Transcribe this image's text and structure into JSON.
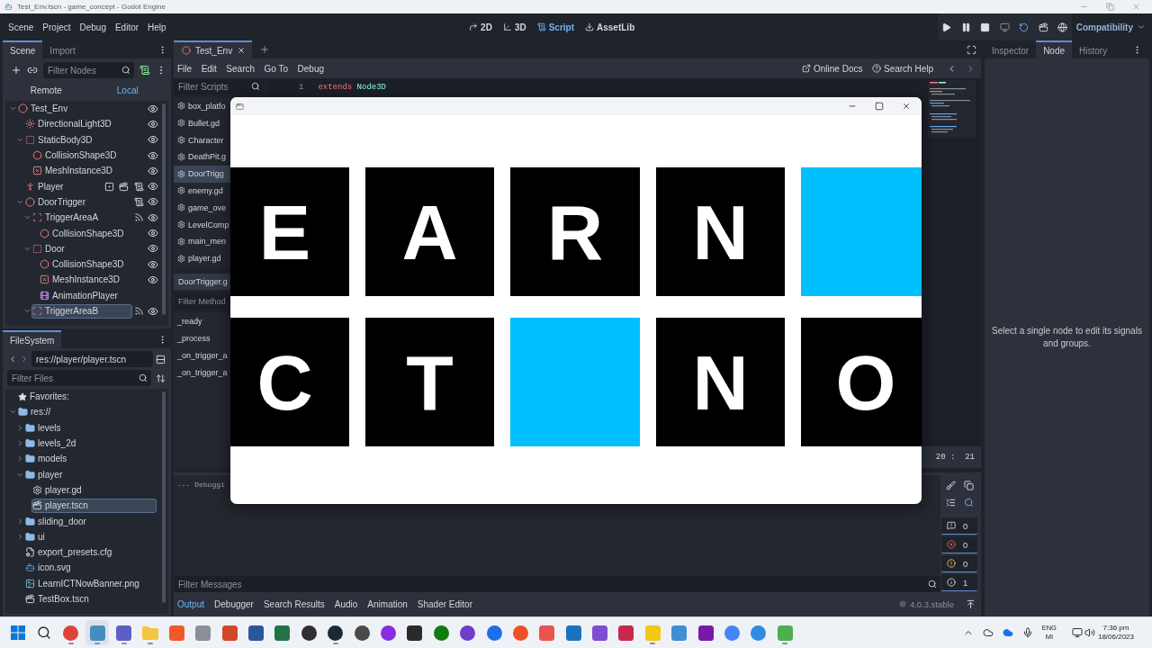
{
  "window": {
    "title": "Test_Env.tscn - game_concept - Godot Engine"
  },
  "menu_bar": {
    "menus": [
      "Scene",
      "Project",
      "Debug",
      "Editor",
      "Help"
    ],
    "workspaces": [
      {
        "kind": "canvas",
        "label": "2D",
        "selected": false
      },
      {
        "kind": "spatial",
        "label": "3D",
        "selected": false
      },
      {
        "kind": "script",
        "label": "Script",
        "selected": true
      },
      {
        "kind": "assetlib",
        "label": "AssetLib",
        "selected": false
      }
    ],
    "renderer": "Compatibility"
  },
  "scene_dock": {
    "tabs": [
      {
        "label": "Scene",
        "selected": true
      },
      {
        "label": "Import",
        "selected": false
      }
    ],
    "filter": {
      "placeholder": "Filter Nodes"
    },
    "modes": [
      {
        "label": "Remote",
        "selected": false
      },
      {
        "label": "Local",
        "selected": true
      }
    ],
    "tree": [
      {
        "name": "Test_Env",
        "kind": "node3d",
        "expanded": true,
        "selected": false,
        "visibility_toggle": true,
        "children": [
          {
            "name": "DirectionalLight3D",
            "kind": "light",
            "selected": false,
            "visibility_toggle": true
          },
          {
            "name": "StaticBody3D",
            "kind": "body",
            "expanded": true,
            "selected": false,
            "visibility_toggle": true,
            "children": [
              {
                "name": "CollisionShape3D",
                "kind": "shape",
                "selected": false,
                "visibility_toggle": true
              },
              {
                "name": "MeshInstance3D",
                "kind": "mesh",
                "selected": false,
                "visibility_toggle": true
              }
            ]
          },
          {
            "name": "Player",
            "kind": "character",
            "selected": false,
            "visibility_toggle": true,
            "indicators": [
              {
                "kind": "group"
              },
              {
                "kind": "scene"
              },
              {
                "kind": "script"
              }
            ]
          },
          {
            "name": "DoorTrigger",
            "kind": "node3d",
            "expanded": true,
            "selected": false,
            "visibility_toggle": true,
            "indicators": [
              {
                "kind": "script"
              }
            ],
            "children": [
              {
                "name": "TriggerAreaA",
                "kind": "area",
                "expanded": true,
                "selected": false,
                "visibility_toggle": true,
                "indicators": [
                  {
                    "kind": "signal"
                  }
                ],
                "children": [
                  {
                    "name": "CollisionShape3D",
                    "kind": "shape",
                    "selected": false,
                    "visibility_toggle": true
                  }
                ]
              },
              {
                "name": "Door",
                "kind": "body",
                "expanded": true,
                "selected": false,
                "visibility_toggle": true,
                "children": [
                  {
                    "name": "CollisionShape3D",
                    "kind": "shape",
                    "selected": false,
                    "visibility_toggle": true
                  },
                  {
                    "name": "MeshInstance3D",
                    "kind": "mesh",
                    "selected": false,
                    "visibility_toggle": true
                  },
                  {
                    "name": "AnimationPlayer",
                    "kind": "animation",
                    "selected": false,
                    "visibility_toggle": false
                  }
                ]
              },
              {
                "name": "TriggerAreaB",
                "kind": "area",
                "expanded": true,
                "selected": true,
                "visibility_toggle": true,
                "indicators": [
                  {
                    "kind": "signal"
                  }
                ]
              }
            ]
          }
        ]
      }
    ]
  },
  "filesystem_dock": {
    "tabs": [
      {
        "label": "FileSystem",
        "selected": true
      }
    ],
    "path": "res://player/player.tscn",
    "filter": {
      "placeholder": "Filter Files"
    },
    "favorites": "Favorites:",
    "tree": [
      {
        "name": "res://",
        "kind": "folder",
        "expanded": true,
        "selected": false,
        "children": [
          {
            "name": "levels",
            "kind": "folder",
            "expanded": false,
            "selected": false
          },
          {
            "name": "levels_2d",
            "kind": "folder",
            "expanded": false,
            "selected": false
          },
          {
            "name": "models",
            "kind": "folder",
            "expanded": false,
            "selected": false
          },
          {
            "name": "player",
            "kind": "folder",
            "expanded": true,
            "selected": false,
            "children": [
              {
                "name": "player.gd",
                "kind": "script",
                "selected": false
              },
              {
                "name": "player.tscn",
                "kind": "scene",
                "selected": true
              }
            ]
          },
          {
            "name": "sliding_door",
            "kind": "folder",
            "expanded": false,
            "selected": false
          },
          {
            "name": "ui",
            "kind": "folder",
            "expanded": false,
            "selected": false
          },
          {
            "name": "export_presets.cfg",
            "kind": "config",
            "selected": false
          },
          {
            "name": "icon.svg",
            "kind": "vector",
            "selected": false
          },
          {
            "name": "LearnICTNowBanner.png",
            "kind": "image",
            "selected": false
          },
          {
            "name": "TestBox.tscn",
            "kind": "scene",
            "selected": false
          }
        ]
      }
    ]
  },
  "script_editor": {
    "tabs": [
      {
        "label": "Test_Env",
        "selected": true
      }
    ],
    "menus": [
      "File",
      "Edit",
      "Search",
      "Go To",
      "Debug"
    ],
    "help": [
      {
        "kind": "docs",
        "label": "Online Docs"
      },
      {
        "kind": "search",
        "label": "Search Help"
      }
    ],
    "script_filter": {
      "placeholder": "Filter Scripts"
    },
    "scripts": [
      {
        "name": "box_platfo",
        "selected": false
      },
      {
        "name": "Bullet.gd",
        "selected": false
      },
      {
        "name": "Character",
        "selected": false
      },
      {
        "name": "DeathPit.g",
        "selected": false
      },
      {
        "name": "DoorTrigg",
        "selected": true
      },
      {
        "name": "enemy.gd",
        "selected": false
      },
      {
        "name": "game_ove",
        "selected": false
      },
      {
        "name": "LevelComp",
        "selected": false
      },
      {
        "name": "main_men",
        "selected": false
      },
      {
        "name": "player.gd",
        "selected": false
      }
    ],
    "current_script": "DoorTrigger.g",
    "method_filter": {
      "placeholder": "Filter Method"
    },
    "methods": [
      "_ready",
      "_process",
      "_on_trigger_a",
      "_on_trigger_a"
    ],
    "code": [
      {
        "number": "1",
        "tokens": [
          {
            "kind": "keyword",
            "text": "extends"
          },
          {
            "kind": "type",
            "text": "Node3D"
          }
        ]
      }
    ],
    "caret": "20 :  21"
  },
  "bottom_panel": {
    "output": [
      "--- Debuggi"
    ],
    "counters": [
      {
        "kind": "message",
        "count": "0"
      },
      {
        "kind": "error",
        "count": "0"
      },
      {
        "kind": "warning",
        "count": "0"
      },
      {
        "kind": "editor",
        "count": "1"
      }
    ],
    "filter": {
      "placeholder": "Filter Messages"
    },
    "tabs": [
      {
        "label": "Output",
        "selected": true
      },
      {
        "label": "Debugger",
        "selected": false
      },
      {
        "label": "Search Results",
        "selected": false
      },
      {
        "label": "Audio",
        "selected": false
      },
      {
        "label": "Animation",
        "selected": false
      },
      {
        "label": "Shader Editor",
        "selected": false
      }
    ],
    "version": "4.0.3.stable"
  },
  "inspector_dock": {
    "tabs": [
      {
        "label": "Inspector",
        "selected": false
      },
      {
        "label": "Node",
        "selected": true
      },
      {
        "label": "History",
        "selected": false
      }
    ],
    "message": "Select a single node to edit its signals and groups."
  },
  "game_window": {
    "tiles": [
      [
        {
          "kind": "letter",
          "text": "E"
        },
        {
          "kind": "letter",
          "text": "A"
        },
        {
          "kind": "letter",
          "text": "R"
        },
        {
          "kind": "letter",
          "text": "N"
        },
        {
          "kind": "blank"
        }
      ],
      [
        {
          "kind": "letter",
          "text": "C"
        },
        {
          "kind": "letter",
          "text": "T"
        },
        {
          "kind": "blank"
        },
        {
          "kind": "letter",
          "text": "N"
        },
        {
          "kind": "letter",
          "text": "O"
        }
      ]
    ]
  },
  "taskbar": {
    "apps": [
      {
        "kind": "start",
        "selected": false,
        "running": false
      },
      {
        "kind": "search",
        "selected": false,
        "running": false
      },
      {
        "kind": "circle",
        "color": "#db4437",
        "selected": false,
        "running": true
      },
      {
        "kind": "tile",
        "color": "#478cbf",
        "selected": true,
        "running": true
      },
      {
        "kind": "tile",
        "color": "#5b5fc7",
        "selected": false,
        "running": true
      },
      {
        "kind": "folder",
        "color": "#f4c542",
        "selected": false,
        "running": true
      },
      {
        "kind": "tile",
        "color": "#f05a28",
        "selected": false,
        "running": false
      },
      {
        "kind": "tile",
        "color": "#8a8f99",
        "selected": false,
        "running": false
      },
      {
        "kind": "tile",
        "color": "#d24726",
        "selected": false,
        "running": false
      },
      {
        "kind": "tile",
        "color": "#2b579a",
        "selected": false,
        "running": false
      },
      {
        "kind": "tile",
        "color": "#217346",
        "selected": false,
        "running": false
      },
      {
        "kind": "circle",
        "color": "#302e31",
        "selected": false,
        "running": false
      },
      {
        "kind": "circle",
        "color": "#1b2838",
        "selected": false,
        "running": true
      },
      {
        "kind": "circle",
        "color": "#4a4a4a",
        "selected": false,
        "running": false
      },
      {
        "kind": "circle",
        "color": "#8a2be2",
        "selected": false,
        "running": false
      },
      {
        "kind": "tile",
        "color": "#2a2a2a",
        "selected": false,
        "running": false
      },
      {
        "kind": "circle",
        "color": "#107c10",
        "selected": false,
        "running": false
      },
      {
        "kind": "circle",
        "color": "#6e40c9",
        "selected": false,
        "running": false
      },
      {
        "kind": "circle",
        "color": "#1f6feb",
        "selected": false,
        "running": false
      },
      {
        "kind": "circle",
        "color": "#f04e23",
        "selected": false,
        "running": false
      },
      {
        "kind": "tile",
        "color": "#e8554e",
        "selected": false,
        "running": false
      },
      {
        "kind": "tile",
        "color": "#1b72be",
        "selected": false,
        "running": false
      },
      {
        "kind": "tile",
        "color": "#7e4dd2",
        "selected": false,
        "running": false
      },
      {
        "kind": "tile",
        "color": "#c9284d",
        "selected": false,
        "running": false
      },
      {
        "kind": "tile",
        "color": "#f2c811",
        "selected": false,
        "running": true
      },
      {
        "kind": "tile",
        "color": "#3f8fd2",
        "selected": false,
        "running": false
      },
      {
        "kind": "tile",
        "color": "#7719aa",
        "selected": false,
        "running": false
      },
      {
        "kind": "circle",
        "color": "#4285f4",
        "selected": false,
        "running": false
      },
      {
        "kind": "circle",
        "color": "#2d8ce0",
        "selected": false,
        "running": false
      },
      {
        "kind": "tile",
        "color": "#4caf50",
        "selected": false,
        "running": true
      }
    ],
    "tray": {
      "language": "ENG",
      "layout": "MI",
      "time": "7:36 pm",
      "date": "18/06/2023"
    }
  }
}
